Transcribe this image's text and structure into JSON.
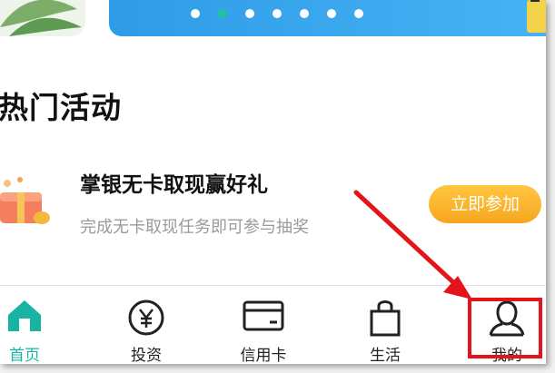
{
  "colors": {
    "accent": "#18b3a2",
    "button": "#f7a61e",
    "banner": "#2f9be8",
    "annotation": "#e3151a"
  },
  "banner": {
    "dot_count": 7,
    "active_dot": 1
  },
  "activities": {
    "title": "热门活动",
    "items": [
      {
        "title": "掌银无卡取现赢好礼",
        "subtitle": "完成无卡取现任务即可参与抽奖",
        "button": "立即参加",
        "icon": "gift-box-icon"
      }
    ]
  },
  "tabbar": {
    "tabs": [
      {
        "label": "首页",
        "icon": "home-icon",
        "active": true
      },
      {
        "label": "投资",
        "icon": "yuan-icon",
        "active": false
      },
      {
        "label": "信用卡",
        "icon": "credit-card-icon",
        "active": false
      },
      {
        "label": "生活",
        "icon": "shopping-bag-icon",
        "active": false
      },
      {
        "label": "我的",
        "icon": "user-icon",
        "active": false
      }
    ]
  }
}
